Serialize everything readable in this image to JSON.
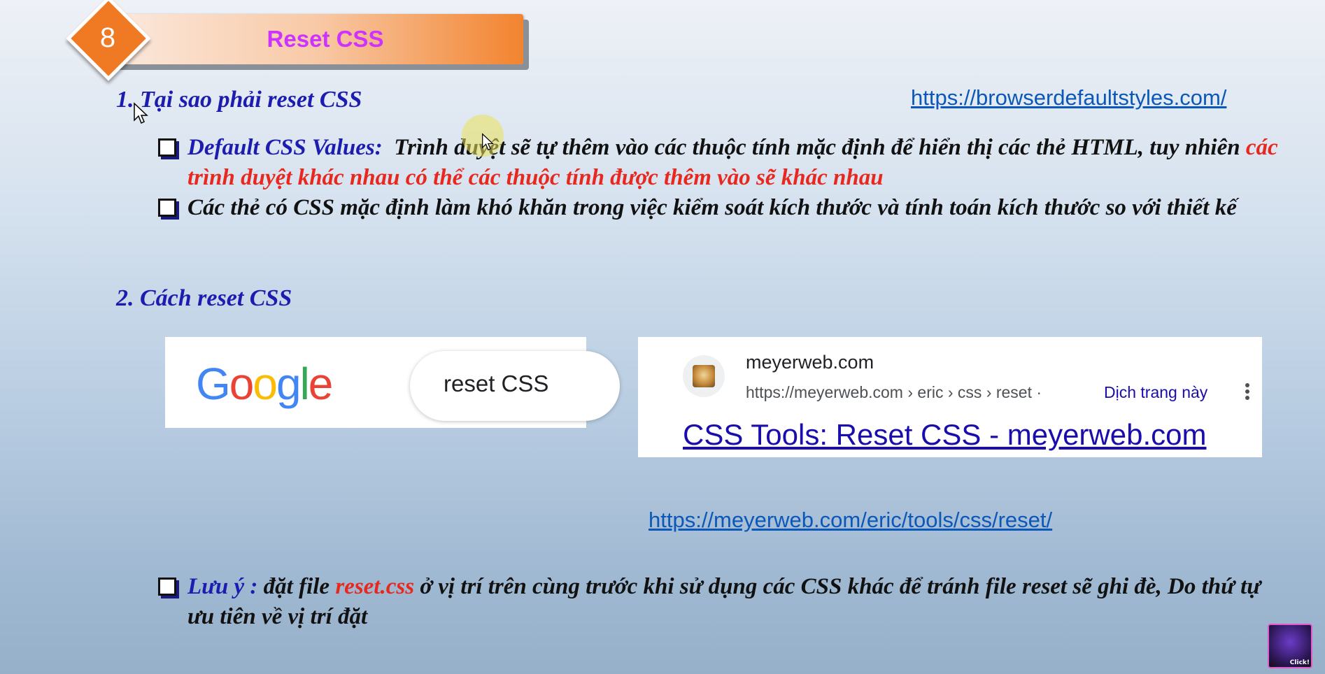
{
  "header": {
    "number": "8",
    "title": "Reset CSS"
  },
  "section1": {
    "heading": "1.  Tại sao phải reset CSS",
    "link": "https://browserdefaultstyles.com/",
    "bullet1": {
      "label": "Default CSS Values:",
      "text": "Trình duyệt sẽ tự thêm vào các thuộc tính mặc định để hiển thị các thẻ HTML, tuy nhiên",
      "highlight": "các trình duyệt khác nhau có thể các thuộc tính được thêm vào sẽ khác nhau"
    },
    "bullet2": {
      "text": "Các thẻ có CSS mặc định làm khó khăn trong việc kiểm soát kích thước và tính toán kích thước so với thiết kế"
    }
  },
  "section2": {
    "heading": "2.   Cách reset CSS",
    "google": {
      "logo": [
        "G",
        "o",
        "o",
        "g",
        "l",
        "e"
      ],
      "logo_colors": [
        "#4285F4",
        "#EA4335",
        "#FBBC05",
        "#4285F4",
        "#34A853",
        "#EA4335"
      ],
      "query": "reset CSS"
    },
    "result": {
      "site": "meyerweb.com",
      "url": "https://meyerweb.com › eric › css › reset",
      "separator": "·",
      "translate": "Dịch trang này",
      "title": "CSS Tools: Reset CSS - meyerweb.com"
    },
    "link": "https://meyerweb.com/eric/tools/css/reset/",
    "note": {
      "label": "Lưu ý :",
      "text1": "đặt file",
      "file": "reset.css",
      "text2": "ở vị trí trên cùng trước khi sử dụng các CSS khác để tránh file reset sẽ ghi đè, Do thứ tự ưu tiên về vị trí đặt"
    }
  },
  "avatar": {
    "badge": "Click!"
  },
  "icons": {
    "slide_number": "diamond-badge-icon",
    "bullet": "checkbox-bullet-icon",
    "more": "kebab-icon",
    "cursor": "mouse-pointer-icon"
  }
}
